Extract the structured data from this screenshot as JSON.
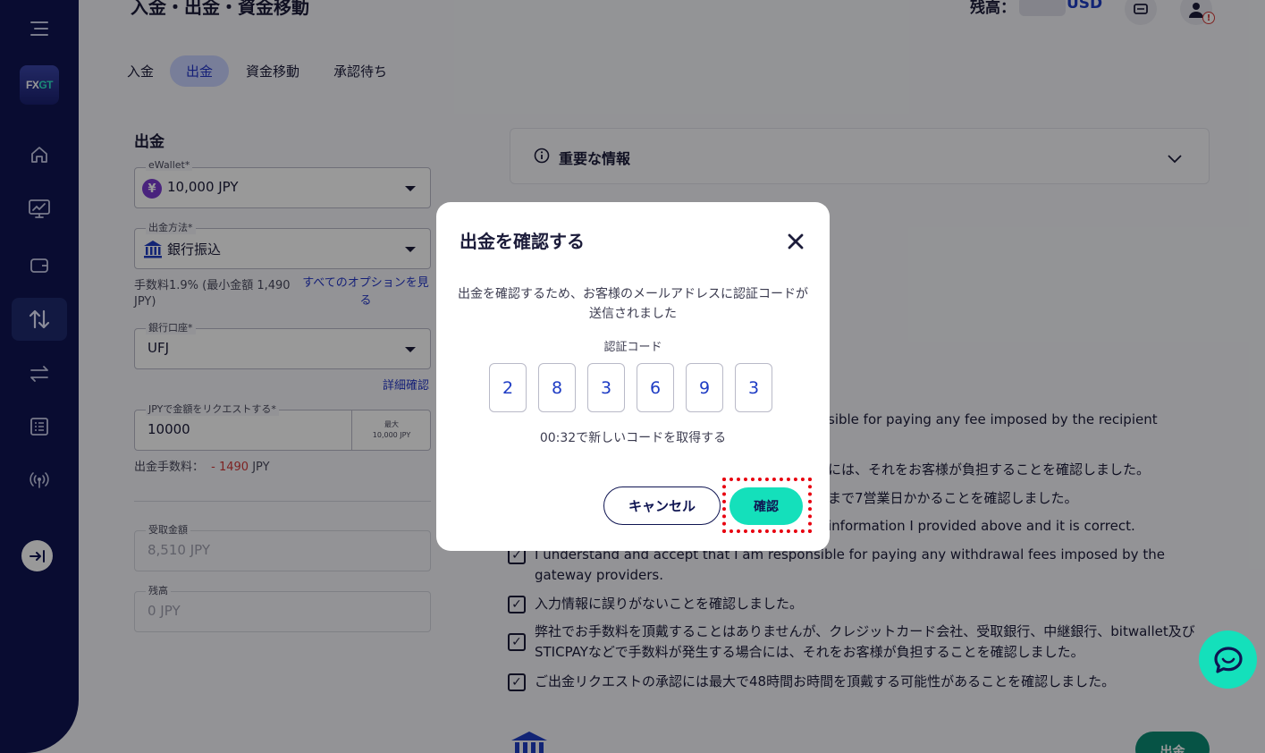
{
  "sidebar": {
    "logo_main": "FX",
    "logo_accent": "GT"
  },
  "header": {
    "title": "入金・出金・資金移動",
    "balance_label": "残高：",
    "balance_currency": "USD"
  },
  "tabs": [
    {
      "label": "入金"
    },
    {
      "label": "出金"
    },
    {
      "label": "資金移動"
    },
    {
      "label": "承認待ち"
    }
  ],
  "form": {
    "section_title": "出金",
    "ewallet": {
      "label": "eWallet*",
      "value": "10,000 JPY"
    },
    "method": {
      "label": "出金方法*",
      "value": "銀行振込"
    },
    "fee_note": "手数料1.9% (最小金額 1,490 JPY)",
    "all_options_link": "すべてのオプションを見る",
    "bank_account": {
      "label": "銀行口座*",
      "value": "UFJ"
    },
    "details_link": "詳細確認",
    "amount": {
      "label": "JPYで金額をリクエストする*",
      "value": "10000",
      "max_label": "最大",
      "max_value": "10,000 JPY"
    },
    "withdraw_fee_label": "出金手数料：",
    "withdraw_fee_value": "- 1490",
    "withdraw_fee_currency": "JPY",
    "received": {
      "label": "受取金額",
      "value": "8,510 JPY"
    },
    "remaining": {
      "label": "残高",
      "value": "0 JPY"
    }
  },
  "info": {
    "title": "重要な情報"
  },
  "bg_fragments": {
    "line1": "sible for paying any fee imposed by the recipient",
    "line2": "には、それをお客様が負担することを確認しました。",
    "line3": "まで7営業日かかることを確認しました。",
    "line4": "information I provided above and it is correct."
  },
  "checkboxes": [
    {
      "text": "I understand and accept that I am responsible for paying any withdrawal fees imposed by the gateway providers."
    },
    {
      "text": "入力情報に誤りがないことを確認しました。"
    },
    {
      "text": "弊社でお手数料を頂戴することはありませんが、クレジットカード会社、受取銀行、中継銀行、bitwallet及びSTICPAYなどで手数料が発生する場合には、それをお客様が負担することを確認しました。"
    },
    {
      "text": "ご出金リクエストの承認には最大で48時間お時間を頂戴する可能性があることを確認しました。"
    }
  ],
  "bottom_button": "出金",
  "modal": {
    "title": "出金を確認する",
    "message": "出金を確認するため、お客様のメールアドレスに認証コードが送信されました",
    "code_label": "認証コード",
    "code_digits": [
      "2",
      "8",
      "3",
      "6",
      "9",
      "3"
    ],
    "resend_text": "00:32で新しいコードを取得する",
    "cancel_label": "キャンセル",
    "confirm_label": "確認"
  },
  "colors": {
    "sidebar_bg": "#0f1552",
    "accent": "#14e0bb",
    "link": "#2436c8",
    "highlight": "#e8000f"
  }
}
